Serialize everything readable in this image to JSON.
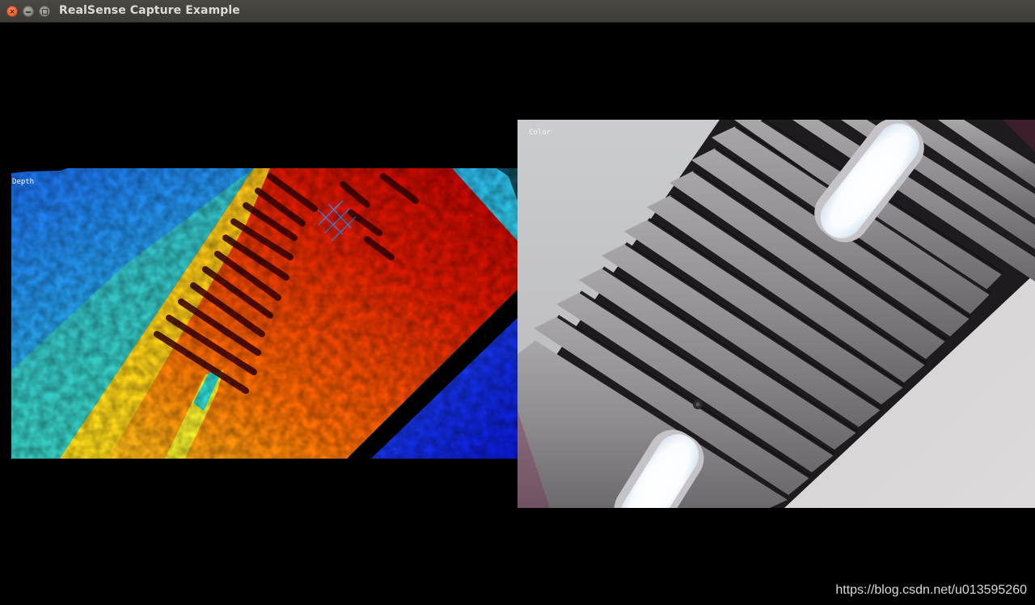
{
  "window": {
    "title": "RealSense Capture Example",
    "controls": {
      "close_icon": "close-icon",
      "minimize_icon": "minimize-icon",
      "maximize_icon": "maximize-icon"
    }
  },
  "streams": {
    "depth": {
      "label": "Depth",
      "colormap": "jet"
    },
    "color": {
      "label": "Color"
    }
  },
  "watermark": "https://blog.csdn.net/u013595260",
  "colors": {
    "background": "#000000",
    "titlebar": "#3c3b37",
    "close_button": "#e95420"
  }
}
